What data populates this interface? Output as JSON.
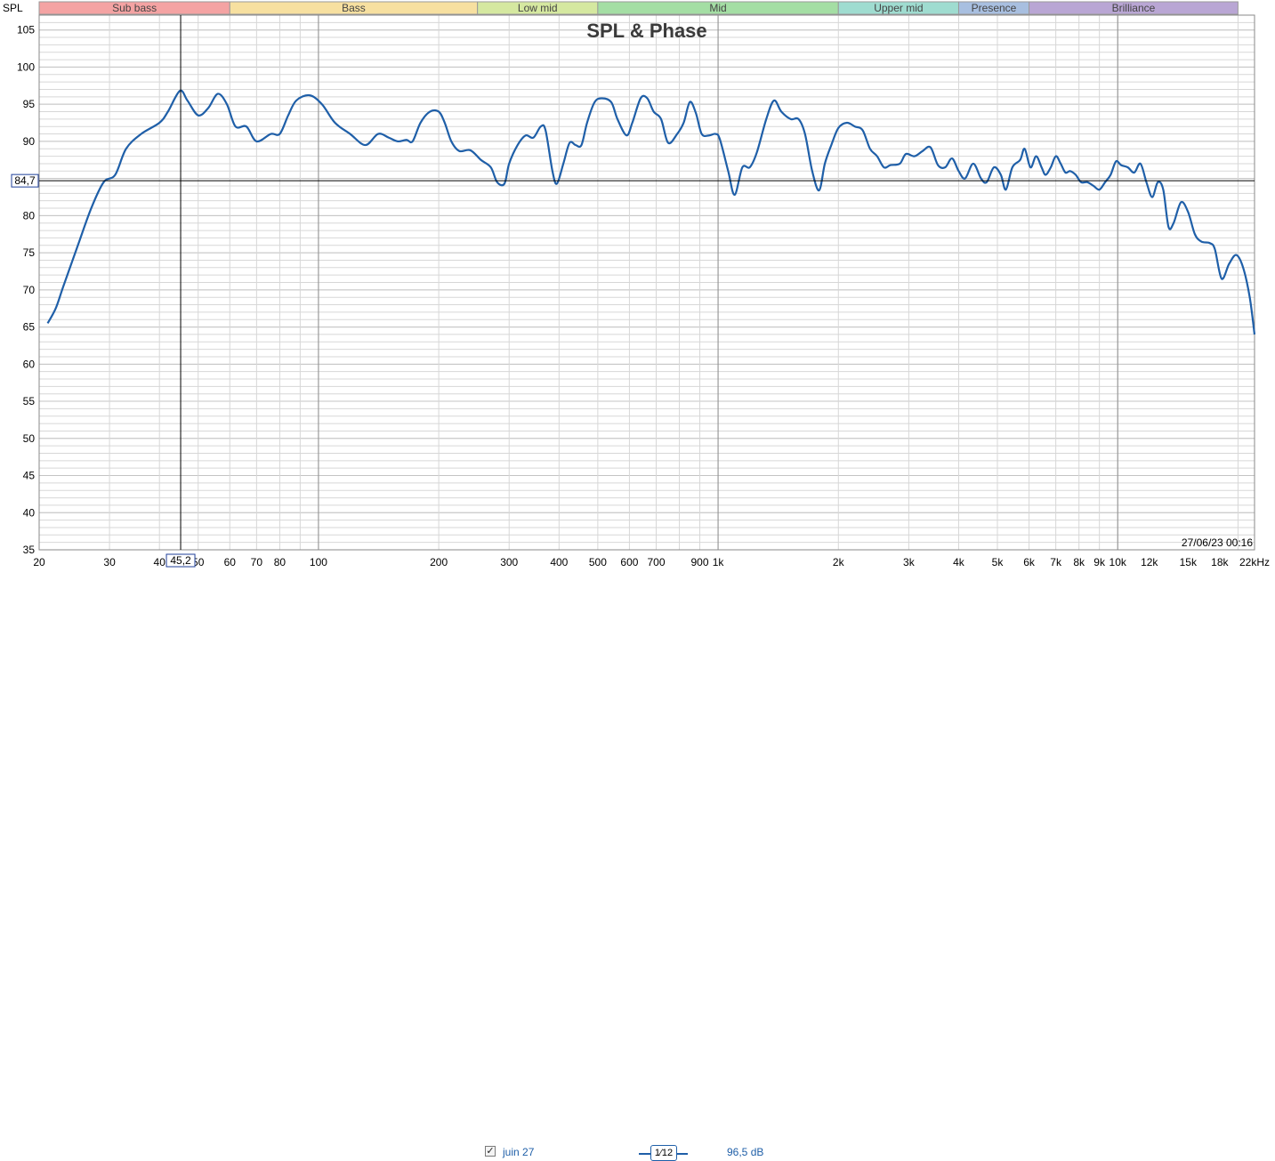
{
  "window": {
    "title": "SPL & Phase",
    "timestamp": "27/06/23 00:16"
  },
  "colors": {
    "curve": "#1f5fa8",
    "grid_major": "#8c8c8c",
    "grid_minor": "#d7d7d7",
    "cursor": "#000000",
    "background": "#ffffff"
  },
  "bands": [
    {
      "label": "Sub bass",
      "f_start": 20,
      "f_end": 60,
      "color": "#f4a3a3"
    },
    {
      "label": "Bass",
      "f_start": 60,
      "f_end": 250,
      "color": "#f7e0a0"
    },
    {
      "label": "Low mid",
      "f_start": 250,
      "f_end": 500,
      "color": "#d5e8a0"
    },
    {
      "label": "Mid",
      "f_start": 500,
      "f_end": 2000,
      "color": "#a4dea4"
    },
    {
      "label": "Upper mid",
      "f_start": 2000,
      "f_end": 4000,
      "color": "#9fdcd0"
    },
    {
      "label": "Presence",
      "f_start": 4000,
      "f_end": 6000,
      "color": "#a8bfe0"
    },
    {
      "label": "Brilliance",
      "f_start": 6000,
      "f_end": 20000,
      "color": "#b9a6d4"
    }
  ],
  "cursor": {
    "freq": 45.2,
    "freq_label": "45,2",
    "spl": 84.7,
    "spl_label": "84,7"
  },
  "legend": {
    "checked": "✓",
    "name": "juin 27",
    "smoothing_label": "1⁄12",
    "value": "96,5 dB"
  },
  "chart_data": {
    "type": "line",
    "title": "SPL & Phase",
    "ylabel": "SPL",
    "xlabel": "",
    "x_scale": "log",
    "xlim": [
      20,
      22000
    ],
    "ylim": [
      35,
      107
    ],
    "x_unit": "Hz",
    "y_unit": "dB",
    "y_ticks": [
      35,
      40,
      45,
      50,
      55,
      60,
      65,
      70,
      75,
      80,
      85,
      90,
      95,
      100,
      105
    ],
    "x_ticks": [
      {
        "value": 20,
        "label": "20",
        "color": "#000000"
      },
      {
        "value": 30,
        "label": "30",
        "color": "#000000"
      },
      {
        "value": 40,
        "label": "40",
        "color": "#000000"
      },
      {
        "value": 50,
        "label": "50",
        "color": "#000000"
      },
      {
        "value": 60,
        "label": "60",
        "color": "#000000"
      },
      {
        "value": 70,
        "label": "70",
        "color": "#000000"
      },
      {
        "value": 80,
        "label": "80",
        "color": "#000000"
      },
      {
        "value": 100,
        "label": "100",
        "color": "#000000"
      },
      {
        "value": 200,
        "label": "200",
        "color": "#000000"
      },
      {
        "value": 300,
        "label": "300",
        "color": "#000000"
      },
      {
        "value": 400,
        "label": "400",
        "color": "#000000"
      },
      {
        "value": 500,
        "label": "500",
        "color": "#000000"
      },
      {
        "value": 600,
        "label": "600",
        "color": "#000000"
      },
      {
        "value": 700,
        "label": "700",
        "color": "#000000"
      },
      {
        "value": 900,
        "label": "900",
        "color": "#000000"
      },
      {
        "value": 1000,
        "label": "1k",
        "color": "#000000"
      },
      {
        "value": 2000,
        "label": "2k",
        "color": "#000000"
      },
      {
        "value": 3000,
        "label": "3k",
        "color": "#000000"
      },
      {
        "value": 4000,
        "label": "4k",
        "color": "#000000"
      },
      {
        "value": 5000,
        "label": "5k",
        "color": "#000000"
      },
      {
        "value": 6000,
        "label": "6k",
        "color": "#000000"
      },
      {
        "value": 7000,
        "label": "7k",
        "color": "#000000"
      },
      {
        "value": 8000,
        "label": "8k",
        "color": "#000000"
      },
      {
        "value": 9000,
        "label": "9k",
        "color": "#000000"
      },
      {
        "value": 10000,
        "label": "10k",
        "color": "#000000"
      },
      {
        "value": 12000,
        "label": "12k",
        "color": "#9a9a9a"
      },
      {
        "value": 15000,
        "label": "15k",
        "color": "#9a9a9a"
      },
      {
        "value": 18000,
        "label": "18k",
        "color": "#9a9a9a"
      },
      {
        "value": 22000,
        "label": "22kHz",
        "color": "#000000"
      }
    ],
    "series": [
      {
        "name": "juin 27",
        "color": "#1f5fa8",
        "points": [
          [
            21,
            65.5
          ],
          [
            22,
            67.5
          ],
          [
            23,
            70.5
          ],
          [
            25,
            76.0
          ],
          [
            27,
            81.0
          ],
          [
            29,
            84.5
          ],
          [
            31,
            85.5
          ],
          [
            33,
            89.0
          ],
          [
            36,
            91.0
          ],
          [
            40,
            92.5
          ],
          [
            42,
            94.0
          ],
          [
            45,
            96.8
          ],
          [
            47,
            95.5
          ],
          [
            50,
            93.5
          ],
          [
            53,
            94.5
          ],
          [
            56,
            96.4
          ],
          [
            59,
            95.0
          ],
          [
            62,
            92.0
          ],
          [
            66,
            92.0
          ],
          [
            70,
            90.0
          ],
          [
            76,
            91.0
          ],
          [
            80,
            91.0
          ],
          [
            84,
            93.5
          ],
          [
            88,
            95.5
          ],
          [
            95,
            96.2
          ],
          [
            102,
            95.0
          ],
          [
            110,
            92.5
          ],
          [
            120,
            91.0
          ],
          [
            131,
            89.5
          ],
          [
            141,
            91.0
          ],
          [
            150,
            90.5
          ],
          [
            158,
            90.0
          ],
          [
            166,
            90.2
          ],
          [
            172,
            90.0
          ],
          [
            180,
            92.5
          ],
          [
            190,
            94.0
          ],
          [
            200,
            94.0
          ],
          [
            207,
            92.5
          ],
          [
            215,
            90.0
          ],
          [
            225,
            88.7
          ],
          [
            240,
            88.8
          ],
          [
            255,
            87.5
          ],
          [
            270,
            86.5
          ],
          [
            280,
            84.5
          ],
          [
            292,
            84.3
          ],
          [
            300,
            87.0
          ],
          [
            315,
            89.5
          ],
          [
            330,
            90.8
          ],
          [
            345,
            90.5
          ],
          [
            360,
            92.0
          ],
          [
            370,
            91.5
          ],
          [
            385,
            86.0
          ],
          [
            395,
            84.3
          ],
          [
            410,
            87.0
          ],
          [
            425,
            89.8
          ],
          [
            440,
            89.5
          ],
          [
            455,
            89.5
          ],
          [
            470,
            92.5
          ],
          [
            490,
            95.2
          ],
          [
            510,
            95.8
          ],
          [
            540,
            95.3
          ],
          [
            560,
            93.0
          ],
          [
            590,
            90.8
          ],
          [
            610,
            92.5
          ],
          [
            640,
            95.8
          ],
          [
            665,
            95.8
          ],
          [
            690,
            94.0
          ],
          [
            720,
            93.0
          ],
          [
            750,
            89.8
          ],
          [
            790,
            91.0
          ],
          [
            820,
            92.5
          ],
          [
            850,
            95.3
          ],
          [
            880,
            93.8
          ],
          [
            910,
            91.0
          ],
          [
            950,
            90.8
          ],
          [
            985,
            91.0
          ],
          [
            1010,
            90.3
          ],
          [
            1060,
            86.0
          ],
          [
            1100,
            82.8
          ],
          [
            1150,
            86.5
          ],
          [
            1200,
            86.5
          ],
          [
            1250,
            88.5
          ],
          [
            1320,
            93.0
          ],
          [
            1380,
            95.5
          ],
          [
            1440,
            94.0
          ],
          [
            1520,
            93.0
          ],
          [
            1590,
            93.0
          ],
          [
            1650,
            91.0
          ],
          [
            1720,
            86.0
          ],
          [
            1790,
            83.4
          ],
          [
            1850,
            87.0
          ],
          [
            1920,
            89.5
          ],
          [
            2000,
            91.8
          ],
          [
            2100,
            92.5
          ],
          [
            2200,
            92.0
          ],
          [
            2300,
            91.5
          ],
          [
            2400,
            89.0
          ],
          [
            2500,
            88.0
          ],
          [
            2600,
            86.5
          ],
          [
            2700,
            86.8
          ],
          [
            2850,
            87.0
          ],
          [
            2950,
            88.3
          ],
          [
            3100,
            88.0
          ],
          [
            3250,
            88.7
          ],
          [
            3400,
            89.2
          ],
          [
            3550,
            86.8
          ],
          [
            3700,
            86.5
          ],
          [
            3850,
            87.7
          ],
          [
            4000,
            86.0
          ],
          [
            4150,
            85.0
          ],
          [
            4350,
            87.0
          ],
          [
            4550,
            85.0
          ],
          [
            4700,
            84.5
          ],
          [
            4900,
            86.5
          ],
          [
            5100,
            85.5
          ],
          [
            5250,
            83.5
          ],
          [
            5450,
            86.5
          ],
          [
            5700,
            87.5
          ],
          [
            5850,
            89.0
          ],
          [
            6050,
            86.5
          ],
          [
            6250,
            88.0
          ],
          [
            6450,
            86.5
          ],
          [
            6600,
            85.5
          ],
          [
            6800,
            86.5
          ],
          [
            7000,
            88.0
          ],
          [
            7200,
            87.0
          ],
          [
            7400,
            85.8
          ],
          [
            7600,
            86.0
          ],
          [
            7850,
            85.5
          ],
          [
            8100,
            84.5
          ],
          [
            8400,
            84.5
          ],
          [
            8700,
            84.0
          ],
          [
            9000,
            83.5
          ],
          [
            9300,
            84.5
          ],
          [
            9600,
            85.5
          ],
          [
            9900,
            87.3
          ],
          [
            10200,
            86.8
          ],
          [
            10600,
            86.5
          ],
          [
            11000,
            85.8
          ],
          [
            11400,
            87.0
          ],
          [
            11800,
            84.5
          ],
          [
            12200,
            82.5
          ],
          [
            12600,
            84.5
          ],
          [
            13000,
            83.5
          ],
          [
            13400,
            78.5
          ],
          [
            13800,
            79.0
          ],
          [
            14400,
            81.8
          ],
          [
            15000,
            80.5
          ],
          [
            15600,
            77.5
          ],
          [
            16200,
            76.5
          ],
          [
            17000,
            76.3
          ],
          [
            17500,
            75.5
          ],
          [
            18200,
            71.5
          ],
          [
            19000,
            73.5
          ],
          [
            19800,
            74.7
          ],
          [
            20600,
            73.0
          ],
          [
            21400,
            69.0
          ],
          [
            22000,
            64.0
          ]
        ]
      }
    ]
  }
}
